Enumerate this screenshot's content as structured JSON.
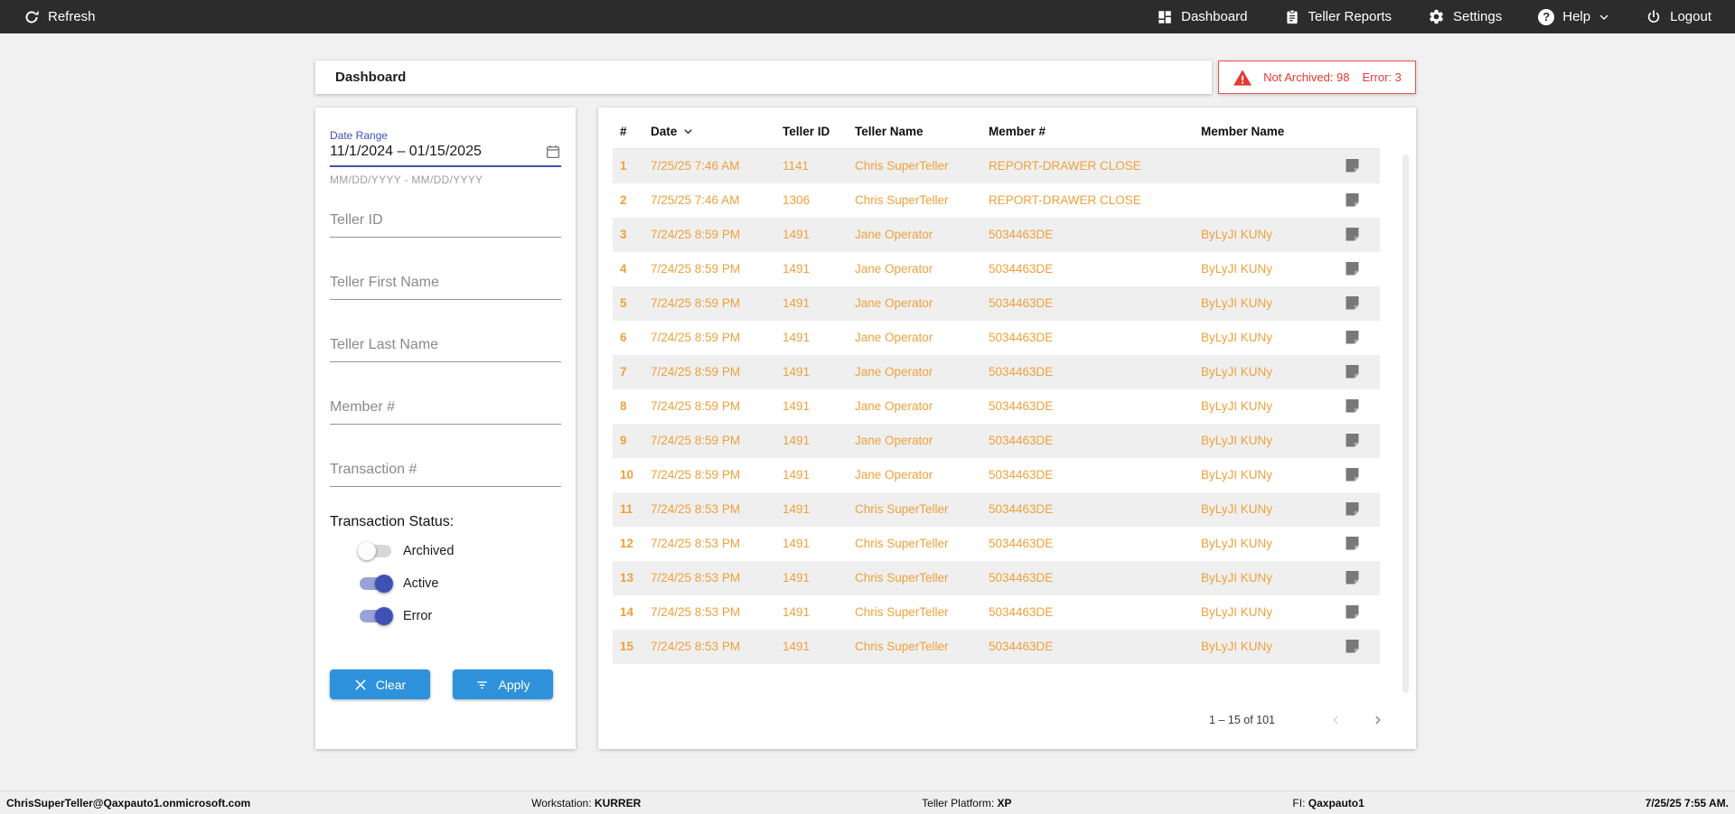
{
  "topnav": {
    "refresh_label": "Refresh",
    "dashboard_label": "Dashboard",
    "teller_reports_label": "Teller Reports",
    "settings_label": "Settings",
    "help_label": "Help",
    "logout_label": "Logout"
  },
  "header": {
    "title": "Dashboard",
    "alert": {
      "not_archived": "Not Archived: 98",
      "error": "Error: 3"
    }
  },
  "filters": {
    "date_range": {
      "label": "Date Range",
      "value": "11/1/2024 – 01/15/2025",
      "helper": "MM/DD/YYYY - MM/DD/YYYY"
    },
    "teller_id_placeholder": "Teller ID",
    "teller_first_name_placeholder": "Teller First Name",
    "teller_last_name_placeholder": "Teller Last Name",
    "member_number_placeholder": "Member #",
    "transaction_number_placeholder": "Transaction #",
    "status_label": "Transaction Status:",
    "toggles": [
      {
        "label": "Archived",
        "on": false
      },
      {
        "label": "Active",
        "on": true
      },
      {
        "label": "Error",
        "on": true
      }
    ],
    "clear_label": "Clear",
    "apply_label": "Apply"
  },
  "table": {
    "columns": [
      "#",
      "Date",
      "Teller ID",
      "Teller Name",
      "Member #",
      "Member Name"
    ],
    "rows": [
      {
        "num": "1",
        "date": "7/25/25 7:46 AM",
        "teller_id": "1141",
        "teller_name": "Chris SuperTeller",
        "member_number": "REPORT-DRAWER CLOSE",
        "member_name": ""
      },
      {
        "num": "2",
        "date": "7/25/25 7:46 AM",
        "teller_id": "1306",
        "teller_name": "Chris SuperTeller",
        "member_number": "REPORT-DRAWER CLOSE",
        "member_name": ""
      },
      {
        "num": "3",
        "date": "7/24/25 8:59 PM",
        "teller_id": "1491",
        "teller_name": "Jane Operator",
        "member_number": "5034463DE",
        "member_name": "ByLyJI KUNy"
      },
      {
        "num": "4",
        "date": "7/24/25 8:59 PM",
        "teller_id": "1491",
        "teller_name": "Jane Operator",
        "member_number": "5034463DE",
        "member_name": "ByLyJI KUNy"
      },
      {
        "num": "5",
        "date": "7/24/25 8:59 PM",
        "teller_id": "1491",
        "teller_name": "Jane Operator",
        "member_number": "5034463DE",
        "member_name": "ByLyJI KUNy"
      },
      {
        "num": "6",
        "date": "7/24/25 8:59 PM",
        "teller_id": "1491",
        "teller_name": "Jane Operator",
        "member_number": "5034463DE",
        "member_name": "ByLyJI KUNy"
      },
      {
        "num": "7",
        "date": "7/24/25 8:59 PM",
        "teller_id": "1491",
        "teller_name": "Jane Operator",
        "member_number": "5034463DE",
        "member_name": "ByLyJI KUNy"
      },
      {
        "num": "8",
        "date": "7/24/25 8:59 PM",
        "teller_id": "1491",
        "teller_name": "Jane Operator",
        "member_number": "5034463DE",
        "member_name": "ByLyJI KUNy"
      },
      {
        "num": "9",
        "date": "7/24/25 8:59 PM",
        "teller_id": "1491",
        "teller_name": "Jane Operator",
        "member_number": "5034463DE",
        "member_name": "ByLyJI KUNy"
      },
      {
        "num": "10",
        "date": "7/24/25 8:59 PM",
        "teller_id": "1491",
        "teller_name": "Jane Operator",
        "member_number": "5034463DE",
        "member_name": "ByLyJI KUNy"
      },
      {
        "num": "11",
        "date": "7/24/25 8:53 PM",
        "teller_id": "1491",
        "teller_name": "Chris SuperTeller",
        "member_number": "5034463DE",
        "member_name": "ByLyJI KUNy"
      },
      {
        "num": "12",
        "date": "7/24/25 8:53 PM",
        "teller_id": "1491",
        "teller_name": "Chris SuperTeller",
        "member_number": "5034463DE",
        "member_name": "ByLyJI KUNy"
      },
      {
        "num": "13",
        "date": "7/24/25 8:53 PM",
        "teller_id": "1491",
        "teller_name": "Chris SuperTeller",
        "member_number": "5034463DE",
        "member_name": "ByLyJI KUNy"
      },
      {
        "num": "14",
        "date": "7/24/25 8:53 PM",
        "teller_id": "1491",
        "teller_name": "Chris SuperTeller",
        "member_number": "5034463DE",
        "member_name": "ByLyJI KUNy"
      },
      {
        "num": "15",
        "date": "7/24/25 8:53 PM",
        "teller_id": "1491",
        "teller_name": "Chris SuperTeller",
        "member_number": "5034463DE",
        "member_name": "ByLyJI KUNy"
      }
    ],
    "pagination": "1 – 15 of 101"
  },
  "footer": {
    "user": "ChrisSuperTeller@Qaxpauto1.onmicrosoft.com",
    "workstation_label": "Workstation:",
    "workstation": "KURRER",
    "platform_label": "Teller Platform:",
    "platform": "XP",
    "fi_label": "FI:",
    "fi": "Qaxpauto1",
    "datetime": "7/25/25 7:55 AM."
  },
  "colors": {
    "accent": "#2d92db",
    "indigo": "#3f51b5",
    "orange": "#f0a13c",
    "red": "#e53935"
  }
}
